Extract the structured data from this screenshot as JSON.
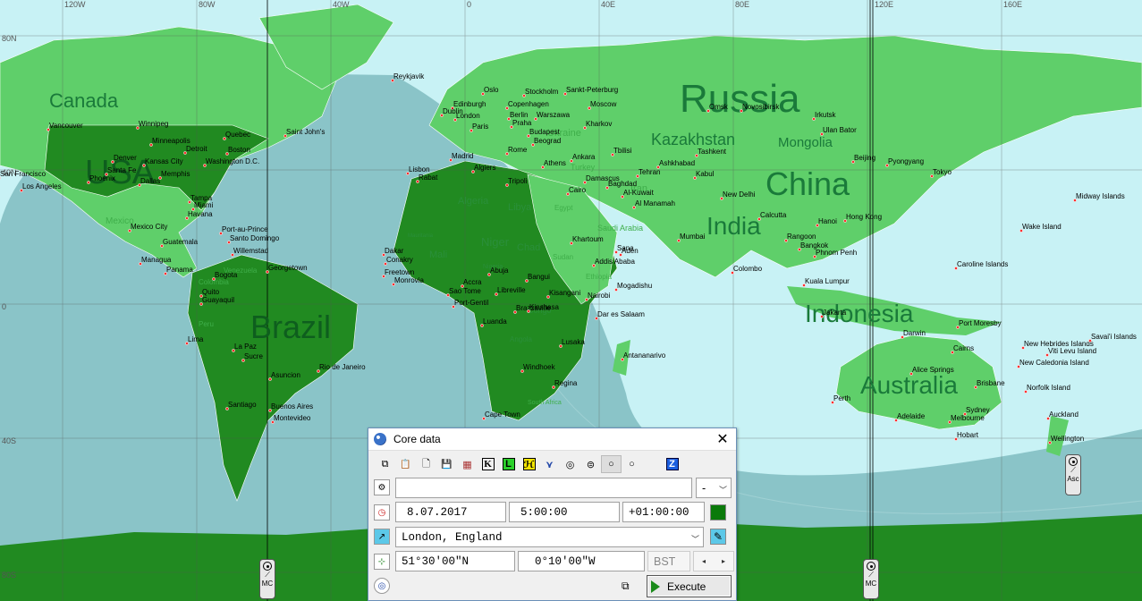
{
  "map": {
    "longitude_labels": [
      "120W",
      "80W",
      "40W",
      "0",
      "40E",
      "80E",
      "120E",
      "160E"
    ],
    "latitude_labels": [
      "80N",
      "40N",
      "0",
      "40S",
      "80S"
    ],
    "country_labels": {
      "large": [
        "Russia",
        "China",
        "USA",
        "Brazil",
        "India",
        "Canada",
        "Indonesia",
        "Australia",
        "Kazakhstan",
        "Mongolia"
      ],
      "medium": [
        "Algeria",
        "Niger",
        "Chad",
        "Libya",
        "Mali",
        "Angola",
        "Saudi Arabia",
        "Iran",
        "Egypt",
        "Sudan",
        "Ethiopia",
        "Mexico",
        "Venezuela",
        "Peru",
        "Ukraine",
        "Turkey",
        "Congo",
        "Mauritania",
        "Nigeria",
        "South Africa",
        "Colombia"
      ]
    },
    "cities": [
      "Reykjavik",
      "Oslo",
      "Stockholm",
      "Sankt-Peterburg",
      "Edinburgh",
      "Copenhagen",
      "Moscow",
      "Dublin",
      "Berlin",
      "Warszawa",
      "London",
      "Praha",
      "Kharkov",
      "Paris",
      "Budapest",
      "Beograd",
      "Ankara",
      "Tbilisi",
      "Madrid",
      "Rome",
      "Athens",
      "Lisbon",
      "Algiers",
      "Tripoli",
      "Rabat",
      "Cairo",
      "Damascus",
      "Baghdad",
      "Tehran",
      "Ashkhabad",
      "Tashkent",
      "Kabul",
      "Omsk",
      "Novosibirsk",
      "Irkutsk",
      "Ulan Bator",
      "Beijing",
      "Pyongyang",
      "Tokyo",
      "Al-Kuwait",
      "Al Manamah",
      "New Delhi",
      "Calcutta",
      "Hanoi",
      "Hong Kong",
      "Khartoum",
      "Sana",
      "Aden",
      "Mumbai",
      "Rangoon",
      "Bangkok",
      "Phnom Penh",
      "Addis Ababa",
      "Mogadishu",
      "Nairobi",
      "Kisangani",
      "Dar es Salaam",
      "Colombo",
      "Kuala Lumpur",
      "Jakarta",
      "Luanda",
      "Lusaka",
      "Antananarivo",
      "Windhoek",
      "Regina",
      "Cape Town",
      "Dakar",
      "Conakry",
      "Freetown",
      "Monrovia",
      "Accra",
      "Sao Tome",
      "Abuja",
      "Bangui",
      "Libreville",
      "Brazzaville",
      "Port-Gentil",
      "Kinshasa",
      "Winnipeg",
      "Minneapolis",
      "Quebec",
      "Boston",
      "Denver",
      "Kansas City",
      "Detroit",
      "Washington D.C.",
      "Memphis",
      "Dallas",
      "Phoenix",
      "Santa Fe",
      "San Francisco",
      "Los Angeles",
      "Vancouver",
      "Saint John's",
      "Tampa",
      "Miami",
      "Havana",
      "Port-au-Prince",
      "Santo Domingo",
      "Willemstad",
      "Mexico City",
      "Guatemala",
      "Managua",
      "Panama",
      "Bogota",
      "Georgetown",
      "Quito",
      "Guayaquil",
      "Lima",
      "La Paz",
      "Sucre",
      "Asuncion",
      "Rio de Janeiro",
      "Santiago",
      "Buenos Aires",
      "Montevideo",
      "Darwin",
      "Cairns",
      "Port Moresby",
      "Alice Springs",
      "Brisbane",
      "Perth",
      "Adelaide",
      "Melbourne",
      "Sydney",
      "Hobart",
      "Auckland",
      "Wellington",
      "Midway Islands",
      "Wake Island",
      "Caroline Islands",
      "New Hebrides Islands",
      "Savai'i Islands",
      "Viti Levu Island",
      "New Caledonia Island",
      "Norfolk Island"
    ],
    "markers": [
      {
        "label": "MC"
      },
      {
        "label": "MC"
      },
      {
        "label": "Asc"
      }
    ]
  },
  "dialog": {
    "title": "Core data",
    "toolbar": [
      {
        "name": "copy-icon",
        "glyph": "⧉"
      },
      {
        "name": "paste-icon",
        "glyph": "📋"
      },
      {
        "name": "new-document-icon",
        "glyph": "🗋"
      },
      {
        "name": "save-icon",
        "glyph": "💾"
      },
      {
        "name": "table-icon",
        "glyph": "▦"
      },
      {
        "name": "k-button",
        "glyph": "K"
      },
      {
        "name": "l-button",
        "glyph": "L"
      },
      {
        "name": "h-button",
        "glyph": "ℋ"
      },
      {
        "name": "magnet-icon",
        "glyph": "⋎"
      },
      {
        "name": "circle-dot-icon",
        "glyph": "◎"
      },
      {
        "name": "sun-s-icon",
        "glyph": "⊜"
      },
      {
        "name": "small-circle-icon",
        "glyph": "○"
      },
      {
        "name": "circle-outline-icon",
        "glyph": "○"
      },
      {
        "name": "z-button",
        "glyph": "Z"
      }
    ],
    "name_field": "",
    "gender_select": "-",
    "date": "8.07.2017",
    "time": "5:00:00",
    "timezone": "+01:00:00",
    "place": "London, England",
    "latitude": "51°30'00\"N",
    "longitude": "0°10'00\"W",
    "zone_abbr": "BST",
    "execute_label": "Execute"
  },
  "colors": {
    "ocean": "#c8f2f5",
    "land_light": "#5fcf6a",
    "land_dark": "#218a21",
    "night_overlay": "#7fbcc0"
  }
}
